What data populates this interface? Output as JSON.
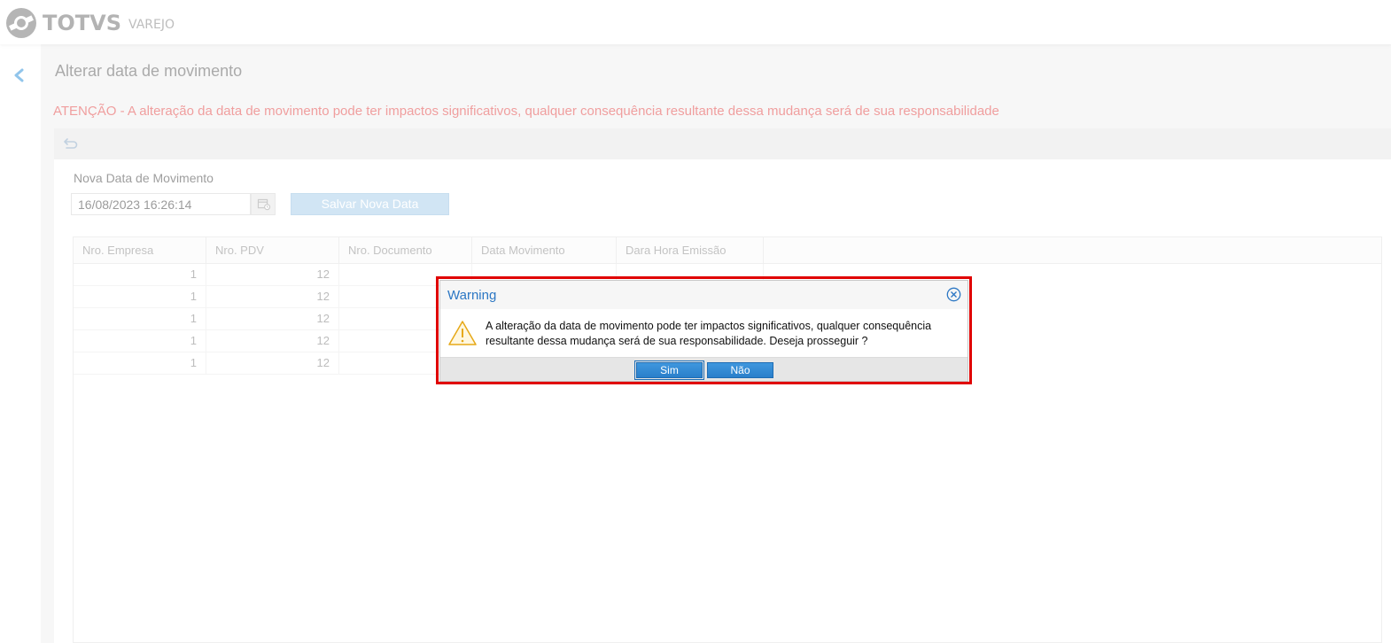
{
  "brand": {
    "name": "TOTVS",
    "sub": "VAREJO"
  },
  "page": {
    "title": "Alterar data de movimento",
    "warning": "ATENÇÃO - A alteração da data de movimento pode ter impactos significativos, qualquer consequência resultante dessa mudança será de sua responsabilidade"
  },
  "form": {
    "label": "Nova Data de Movimento",
    "date_value": "16/08/2023 16:26:14",
    "save_label": "Salvar Nova Data"
  },
  "grid": {
    "columns": [
      "Nro. Empresa",
      "Nro. PDV",
      "Nro. Documento",
      "Data Movimento",
      "Dara Hora Emissão"
    ],
    "rows": [
      {
        "empresa": "1",
        "pdv": "12"
      },
      {
        "empresa": "1",
        "pdv": "12"
      },
      {
        "empresa": "1",
        "pdv": "12"
      },
      {
        "empresa": "1",
        "pdv": "12"
      },
      {
        "empresa": "1",
        "pdv": "12"
      }
    ]
  },
  "dialog": {
    "title": "Warning",
    "message": "A alteração da data de movimento pode ter impactos significativos, qualquer consequência resultante dessa mudança será de sua responsabilidade. Deseja prosseguir ?",
    "yes_label": "Sim",
    "no_label": "Não",
    "icon": "warning-triangle-icon"
  },
  "colors": {
    "warning_text": "#e86a6a",
    "dialog_title": "#2c77c4",
    "button": "#2a7fca",
    "highlight": "#e00000"
  }
}
